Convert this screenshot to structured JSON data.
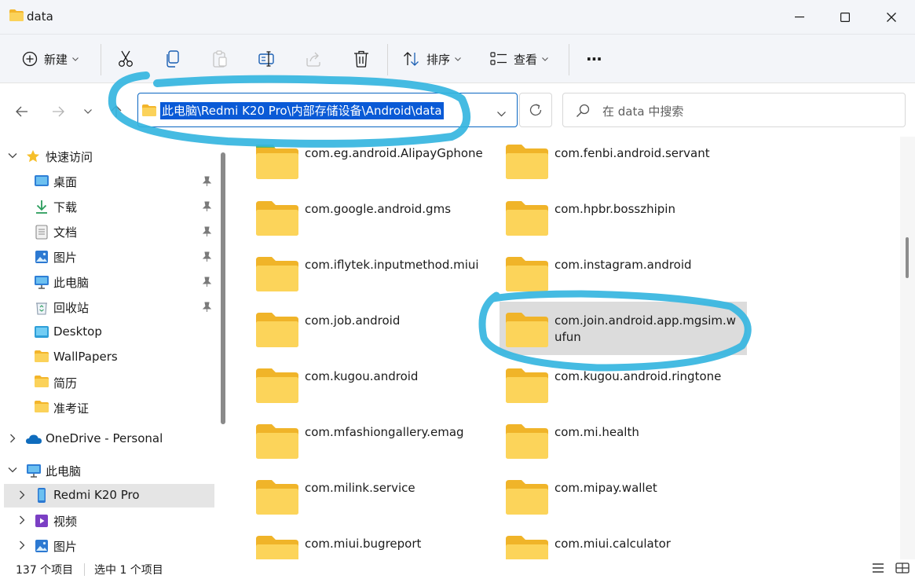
{
  "window": {
    "title": "data"
  },
  "toolbar": {
    "new_label": "新建",
    "sort_label": "排序",
    "view_label": "查看",
    "more_label": "···"
  },
  "address": {
    "path": "此电脑\\Redmi K20 Pro\\内部存储设备\\Android\\data"
  },
  "search": {
    "placeholder": "在 data 中搜索"
  },
  "sidebar": {
    "quick_access": "快速访问",
    "items": [
      {
        "label": "桌面",
        "icon": "desktop-icon"
      },
      {
        "label": "下载",
        "icon": "download-icon"
      },
      {
        "label": "文档",
        "icon": "document-icon"
      },
      {
        "label": "图片",
        "icon": "pictures-icon"
      },
      {
        "label": "此电脑",
        "icon": "computer-icon"
      },
      {
        "label": "回收站",
        "icon": "recycle-bin-icon"
      },
      {
        "label": "Desktop",
        "icon": "folder-icon"
      },
      {
        "label": "WallPapers",
        "icon": "folder-icon"
      },
      {
        "label": "简历",
        "icon": "folder-icon"
      },
      {
        "label": "准考证",
        "icon": "folder-icon"
      }
    ],
    "onedrive": "OneDrive - Personal",
    "this_pc": "此电脑",
    "pc_items": [
      {
        "label": "Redmi K20 Pro",
        "icon": "phone-icon"
      },
      {
        "label": "视频",
        "icon": "video-icon"
      },
      {
        "label": "图片",
        "icon": "pictures-icon"
      }
    ]
  },
  "files": [
    {
      "name": "com.eg.android.AlipayGphone"
    },
    {
      "name": "com.fenbi.android.servant"
    },
    {
      "name": "com.google.android.gms"
    },
    {
      "name": "com.hpbr.bosszhipin"
    },
    {
      "name": "com.iflytek.inputmethod.miui"
    },
    {
      "name": "com.instagram.android"
    },
    {
      "name": "com.job.android"
    },
    {
      "name": "com.join.android.app.mgsim.wufun"
    },
    {
      "name": "com.kugou.android"
    },
    {
      "name": "com.kugou.android.ringtone"
    },
    {
      "name": "com.mfashiongallery.emag"
    },
    {
      "name": "com.mi.health"
    },
    {
      "name": "com.milink.service"
    },
    {
      "name": "com.mipay.wallet"
    },
    {
      "name": "com.miui.bugreport"
    },
    {
      "name": "com.miui.calculator"
    }
  ],
  "status": {
    "item_count": "137 个项目",
    "selected": "选中 1 个项目"
  },
  "colors": {
    "accent": "#0a5ad6",
    "folder": "#f8c93e",
    "annotation": "#35b5e0"
  }
}
